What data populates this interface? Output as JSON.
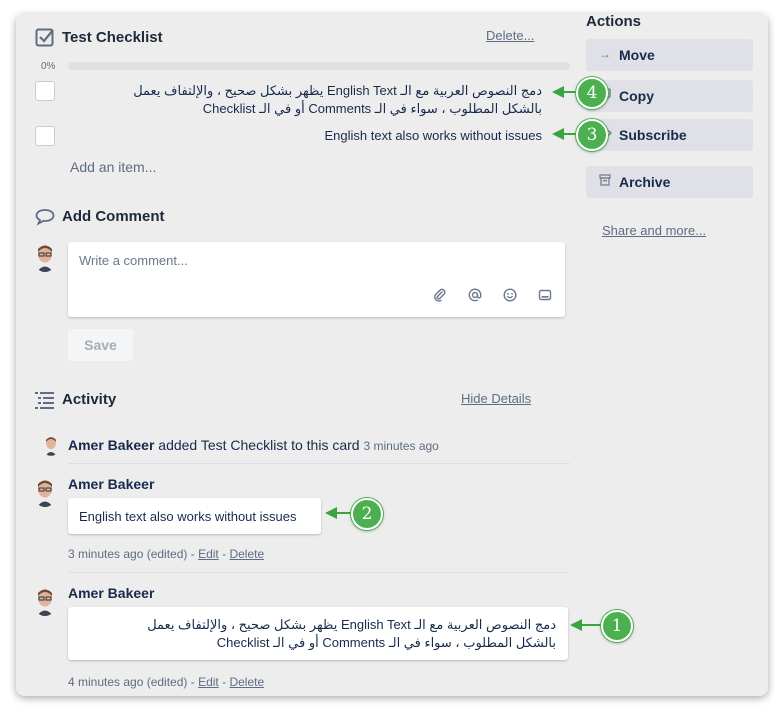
{
  "checklist": {
    "title": "Test Checklist",
    "delete_label": "Delete...",
    "progress_label": "0%",
    "progress": 0,
    "items": [
      {
        "text_line1": "دمج النصوص العربية مع الـ English Text يظهر بشكل صحيح ، والإلتفاف يعمل",
        "text_line2": "بالشكل المطلوب ، سواء في الـ Comments أو في الـ Checklist",
        "marker": "4"
      },
      {
        "text_line1": "English text also works without issues",
        "marker": "3"
      }
    ],
    "add_item_label": "Add an item..."
  },
  "comment": {
    "title": "Add Comment",
    "placeholder": "Write a comment...",
    "save_label": "Save",
    "tool_icons": [
      "paperclip-icon",
      "mention-icon",
      "emoji-icon",
      "card-icon"
    ]
  },
  "activity": {
    "title": "Activity",
    "hide_details_label": "Hide Details",
    "entries": [
      {
        "author": "Amer Bakeer",
        "action": "added Test Checklist to this card",
        "time": "3 minutes ago"
      },
      {
        "author": "Amer Bakeer",
        "comment": "English text also works without issues",
        "meta": "3 minutes ago (edited)",
        "edit_label": "Edit",
        "delete_label": "Delete",
        "marker": "2"
      },
      {
        "author": "Amer Bakeer",
        "comment_line1": "دمج النصوص العربية مع الـ English Text يظهر بشكل صحيح ، والإلتفاف يعمل",
        "comment_line2": "بالشكل المطلوب ، سواء في الـ Comments أو في الـ Checklist",
        "meta": "4 minutes ago (edited)",
        "edit_label": "Edit",
        "delete_label": "Delete",
        "marker": "1"
      }
    ]
  },
  "actions": {
    "title": "Actions",
    "buttons": [
      {
        "label": "Move",
        "icon": "arrow-right-icon"
      },
      {
        "label": "Copy",
        "icon": "copy-icon"
      },
      {
        "label": "Subscribe",
        "icon": "eye-icon"
      },
      {
        "label": "Archive",
        "icon": "archive-icon"
      }
    ],
    "share_label": "Share and more..."
  },
  "colors": {
    "marker": "#4caf50",
    "accent_text": "#172b4d",
    "muted": "#5e6c84"
  }
}
